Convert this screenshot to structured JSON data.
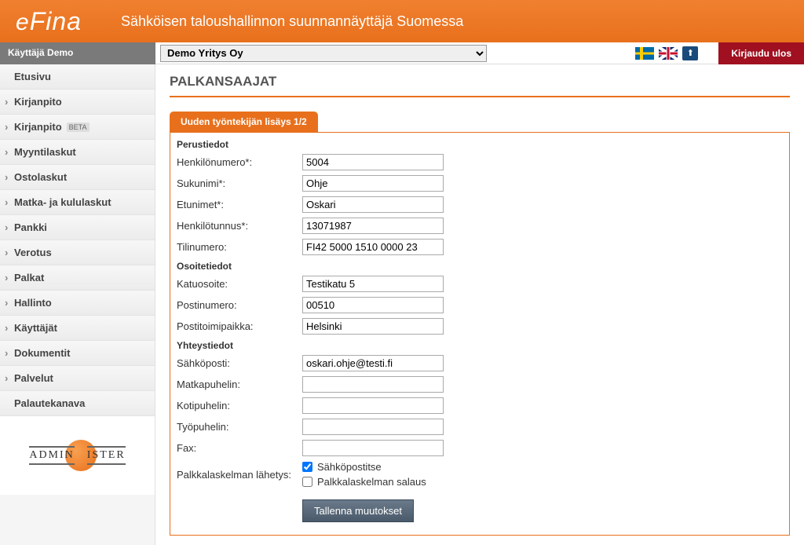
{
  "header": {
    "logo": "eFina",
    "tagline": "Sähköisen taloushallinnon suunnannäyttäjä Suomessa"
  },
  "topbar": {
    "user": "Käyttäjä Demo",
    "company": "Demo Yritys Oy",
    "logout": "Kirjaudu ulos"
  },
  "sidebar": {
    "items": [
      {
        "label": "Etusivu",
        "expandable": false
      },
      {
        "label": "Kirjanpito",
        "expandable": true
      },
      {
        "label": "Kirjanpito",
        "expandable": true,
        "badge": "BETA"
      },
      {
        "label": "Myyntilaskut",
        "expandable": true
      },
      {
        "label": "Ostolaskut",
        "expandable": true
      },
      {
        "label": "Matka- ja kululaskut",
        "expandable": true
      },
      {
        "label": "Pankki",
        "expandable": true
      },
      {
        "label": "Verotus",
        "expandable": true
      },
      {
        "label": "Palkat",
        "expandable": true
      },
      {
        "label": "Hallinto",
        "expandable": true
      },
      {
        "label": "Käyttäjät",
        "expandable": true
      },
      {
        "label": "Dokumentit",
        "expandable": true
      },
      {
        "label": "Palvelut",
        "expandable": true
      },
      {
        "label": "Palautekanava",
        "expandable": false
      }
    ],
    "footer_logo": "ADMINISTER"
  },
  "page": {
    "title": "PALKANSAAJAT",
    "tab": "Uuden työntekijän lisäys 1/2",
    "sections": {
      "perustiedot": "Perustiedot",
      "osoitetiedot": "Osoitetiedot",
      "yhteystiedot": "Yhteystiedot"
    },
    "fields": {
      "henkilonumero": {
        "label": "Henkilönumero*:",
        "value": "5004"
      },
      "sukunimi": {
        "label": "Sukunimi*:",
        "value": "Ohje"
      },
      "etunimet": {
        "label": "Etunimet*:",
        "value": "Oskari"
      },
      "henkilotunnus": {
        "label": "Henkilötunnus*:",
        "value": "13071987"
      },
      "tilinumero": {
        "label": "Tilinumero:",
        "value": "FI42 5000 1510 0000 23"
      },
      "katuosoite": {
        "label": "Katuosoite:",
        "value": "Testikatu 5"
      },
      "postinumero": {
        "label": "Postinumero:",
        "value": "00510"
      },
      "postitoimipaikka": {
        "label": "Postitoimipaikka:",
        "value": "Helsinki"
      },
      "sahkoposti": {
        "label": "Sähköposti:",
        "value": "oskari.ohje@testi.fi"
      },
      "matkapuhelin": {
        "label": "Matkapuhelin:",
        "value": ""
      },
      "kotipuhelin": {
        "label": "Kotipuhelin:",
        "value": ""
      },
      "tyopuhelin": {
        "label": "Työpuhelin:",
        "value": ""
      },
      "fax": {
        "label": "Fax:",
        "value": ""
      },
      "palkkalaskelman": {
        "label": "Palkkalaskelman lähetys:"
      }
    },
    "checkboxes": {
      "sahkopostitse": {
        "label": "Sähköpostitse",
        "checked": true
      },
      "salaus": {
        "label": "Palkkalaskelman salaus",
        "checked": false
      }
    },
    "save_button": "Tallenna muutokset"
  }
}
